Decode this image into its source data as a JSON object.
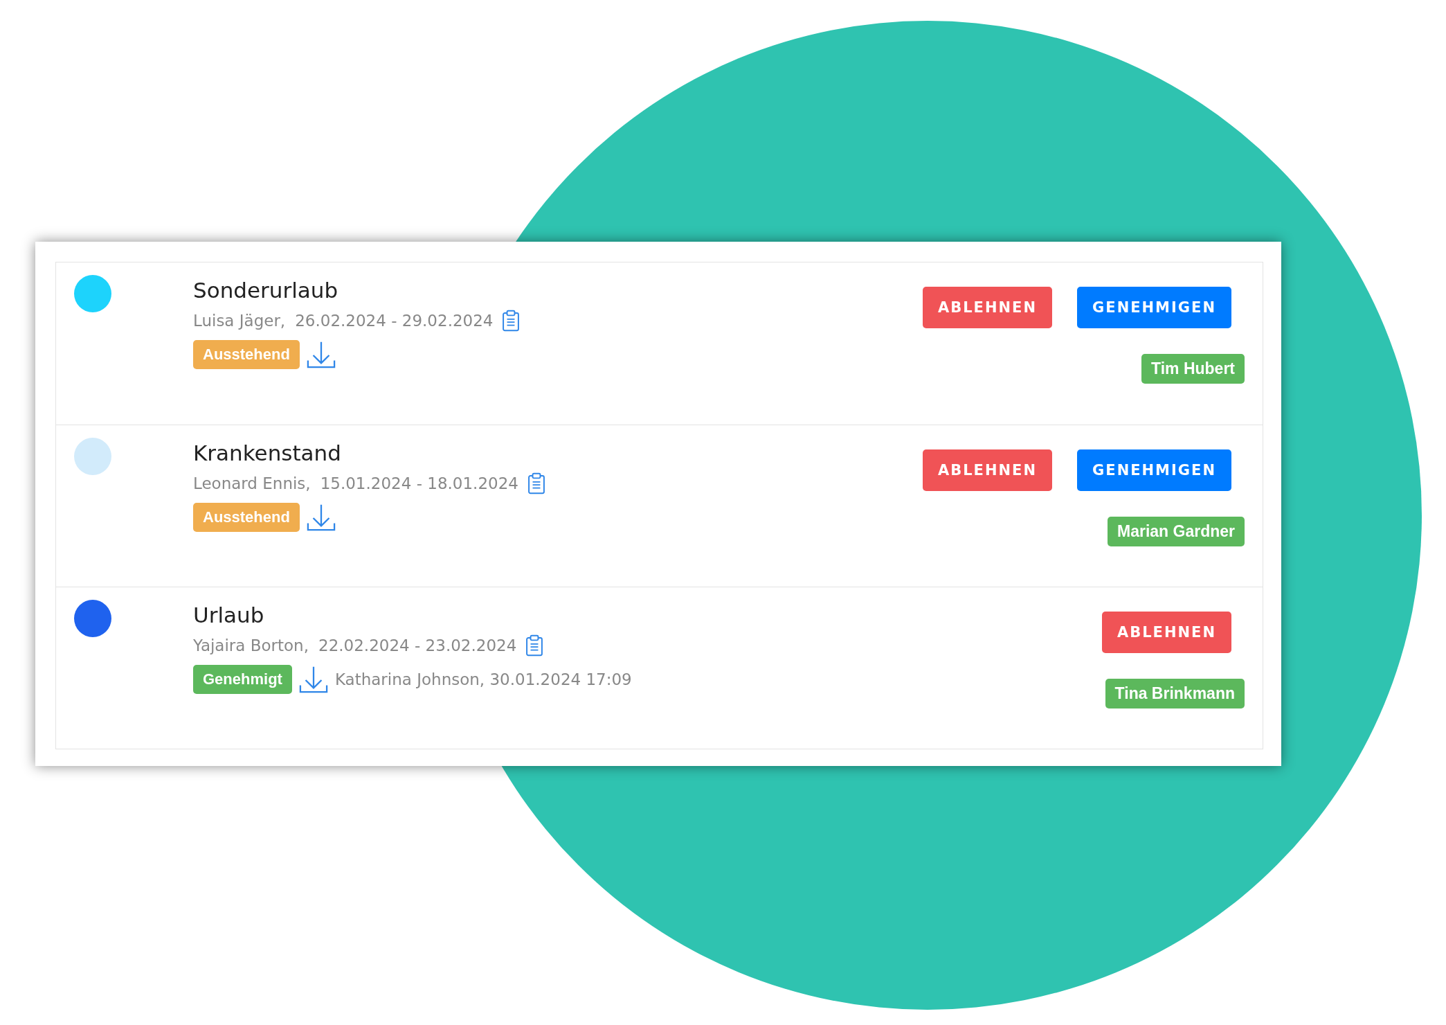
{
  "requests": [
    {
      "title": "Sonderurlaub",
      "person": "Luisa Jäger,",
      "dates": "26.02.2024 - 29.02.2024",
      "color": "#1dd3fc",
      "status": {
        "kind": "pending",
        "label": "Ausstehend"
      },
      "actions": [
        {
          "kind": "reject",
          "label": "ABLEHNEN"
        },
        {
          "kind": "approve",
          "label": "GENEHMIGEN"
        }
      ],
      "assignee": "Tim Hubert"
    },
    {
      "title": "Krankenstand",
      "person": "Leonard Ennis,",
      "dates": "15.01.2024 - 18.01.2024",
      "color": "#d2ebfb",
      "status": {
        "kind": "pending",
        "label": "Ausstehend"
      },
      "actions": [
        {
          "kind": "reject",
          "label": "ABLEHNEN"
        },
        {
          "kind": "approve",
          "label": "GENEHMIGEN"
        }
      ],
      "assignee": "Marian Gardner"
    },
    {
      "title": "Urlaub",
      "person": "Yajaira Borton,",
      "dates": "22.02.2024 - 23.02.2024",
      "color": "#1f62ee",
      "status": {
        "kind": "approved",
        "label": "Genehmigt"
      },
      "approval_note": "Katharina Johnson, 30.01.2024 17:09",
      "actions": [
        {
          "kind": "reject",
          "label": "ABLEHNEN"
        }
      ],
      "assignee": "Tina Brinkmann"
    }
  ]
}
